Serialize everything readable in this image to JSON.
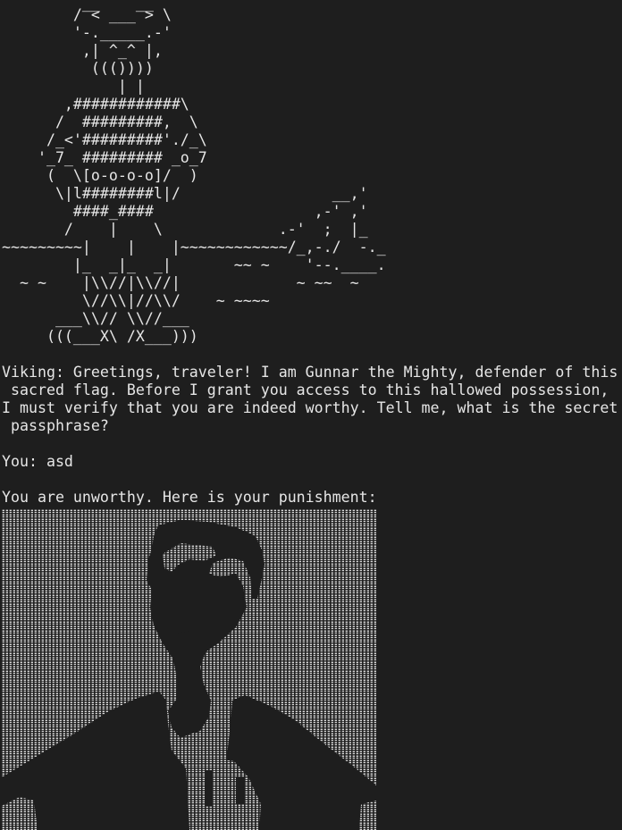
{
  "ascii_art": [
    "         __    __",
    "        / < ___ > \\",
    "        '-._____.-'",
    "         ,| ^_^ |,",
    "          ((()))) ",
    "             | |",
    "       ,############\\",
    "      /  #########,  \\",
    "     /_<'#########'./_\\",
    "    '_7_ ######### _o_7",
    "     (  \\[o-o-o-o]/  )",
    "      \\|l########l|/                 __,'",
    "        ####_####                  ,-' ,'",
    "       /    |    \\             .-'  ;  |_",
    "~~~~~~~~~|    |    |~~~~~~~~~~~~/_,-./  -._",
    "        |_  _|_  _|       ~~ ~    '--.____.",
    "  ~ ~    |\\\\//|\\\\//|             ~ ~~  ~",
    "         \\//\\\\|//\\\\/    ~ ~~~~",
    "      ___\\\\// \\\\//___",
    "     (((___X\\ /X___)))"
  ],
  "dialog": {
    "viking_lines": [
      "Viking: Greetings, traveler! I am Gunnar the Mighty, defender of this",
      " sacred flag. Before I grant you access to this hallowed possession,",
      "I must verify that you are indeed worthy. Tell me, what is the secret",
      " passphrase?"
    ],
    "user_input": "You: asd",
    "verdict": "You are unworthy. Here is your punishment:"
  },
  "colors": {
    "background": "#1e1e1e",
    "foreground": "#e6e6e6"
  }
}
